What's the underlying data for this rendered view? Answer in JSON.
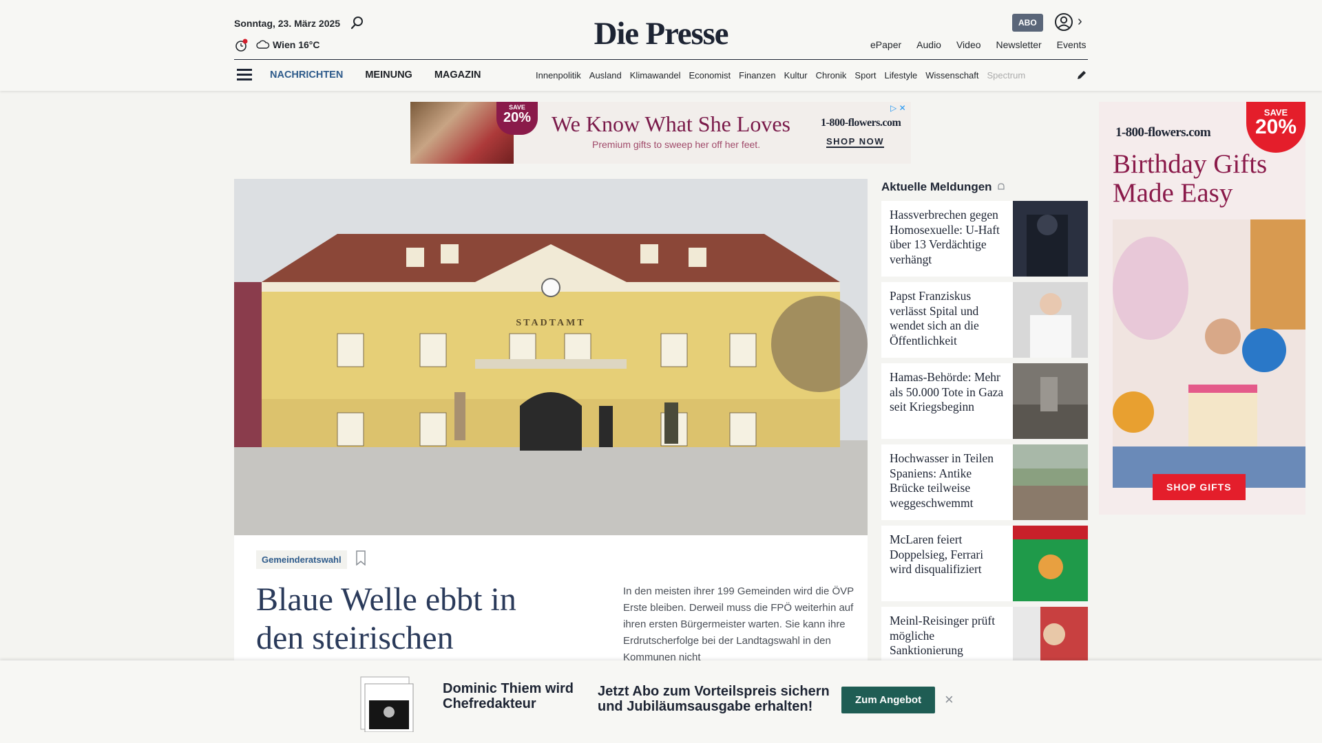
{
  "header": {
    "date": "Sonntag, 23. März 2025",
    "weather": "Wien 16°C",
    "logo": "Die Presse",
    "abo_label": "ABO",
    "top_links": [
      "ePaper",
      "Audio",
      "Video",
      "Newsletter",
      "Events"
    ],
    "main_nav": [
      "NACHRICHTEN",
      "MEINUNG",
      "MAGAZIN"
    ],
    "sub_nav": [
      "Innenpolitik",
      "Ausland",
      "Klimawandel",
      "Economist",
      "Finanzen",
      "Kultur",
      "Chronik",
      "Sport",
      "Lifestyle",
      "Wissenschaft",
      "Spectrum"
    ]
  },
  "ad_top": {
    "badge_small": "SAVE",
    "badge_pct": "20%",
    "headline": "We Know What She Loves",
    "sub": "Premium gifts to sweep her off her feet.",
    "brand": "1-800-flowers.com",
    "cta": "SHOP NOW"
  },
  "article": {
    "hero_sign": "STADTAMT",
    "tag": "Gemeinderatswahl",
    "headline": "Blaue Welle ebbt in den steirischen",
    "teaser": "In den meisten ihrer 199 Gemeinden wird die ÖVP Erste bleiben. Derweil muss die FPÖ weiterhin auf ihren ersten Bürgermeister warten. Sie kann ihre Erdrutscherfolge bei der Landtagswahl in den Kommunen nicht"
  },
  "news": {
    "title": "Aktuelle Meldungen",
    "items": [
      {
        "title": "Hassverbrechen gegen Homosexuelle: U-Haft über 13 Verdächtige verhängt"
      },
      {
        "title": "Papst Franziskus verlässt Spital und wendet sich an die Öffentlichkeit"
      },
      {
        "title": "Hamas-Behörde: Mehr als 50.000 Tote in Gaza seit Kriegsbeginn"
      },
      {
        "title": "Hochwasser in Teilen Spaniens: Antike Brücke teilweise weggeschwemmt"
      },
      {
        "title": "McLaren feiert Doppelsieg, Ferrari wird disqualifiziert"
      },
      {
        "title": "Meinl-Reisinger prüft mögliche Sanktionierung"
      }
    ]
  },
  "ad_side": {
    "brand": "1-800-flowers.com",
    "badge_small": "SAVE",
    "badge_pct": "20%",
    "title": "Birthday Gifts Made Easy",
    "cta": "SHOP GIFTS"
  },
  "promo": {
    "name": "Dominic Thiem wird Chefredakteur",
    "text": "Jetzt Abo zum Vorteilspreis sichern und Jubiläumsausgabe erhalten!",
    "button": "Zum Angebot",
    "close": "×"
  }
}
